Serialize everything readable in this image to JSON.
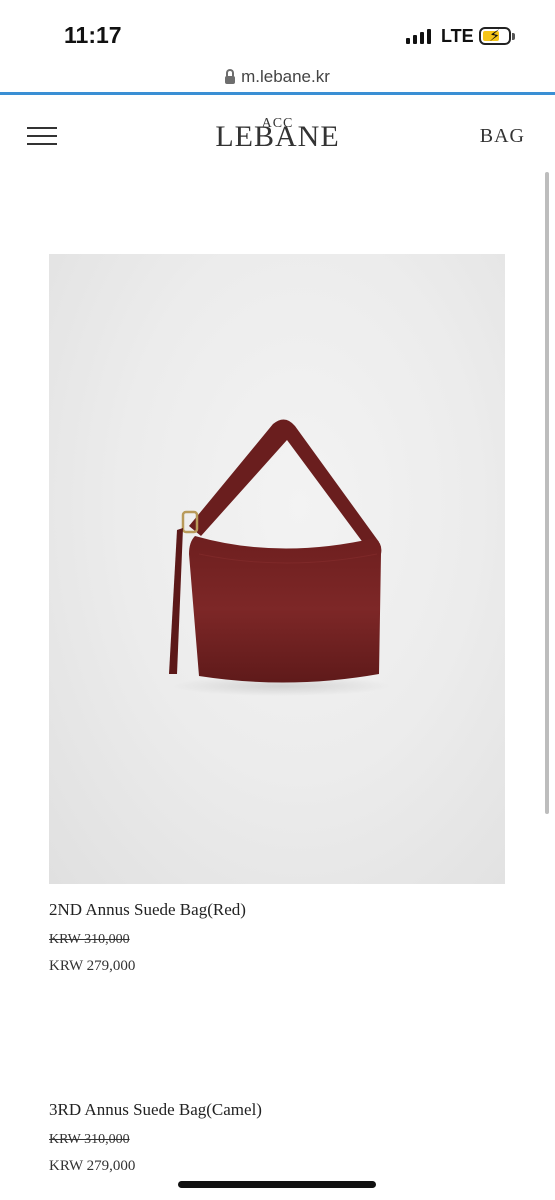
{
  "status_bar": {
    "time": "11:17",
    "network": "LTE"
  },
  "browser": {
    "url": "m.lebane.kr"
  },
  "header": {
    "logo_top": "ACC",
    "logo_main": "LEBANE",
    "category": "BAG"
  },
  "products": [
    {
      "name": "2ND Annus Suede Bag(Red)",
      "original_price": "KRW 310,000",
      "sale_price": "KRW 279,000",
      "bag_color": "#7a2424"
    },
    {
      "name": "3RD Annus Suede Bag(Camel)",
      "original_price": "KRW 310,000",
      "sale_price": "KRW 279,000"
    }
  ],
  "colors": {
    "progress_bar": "#3a8fd4",
    "battery": "#f5c518"
  }
}
